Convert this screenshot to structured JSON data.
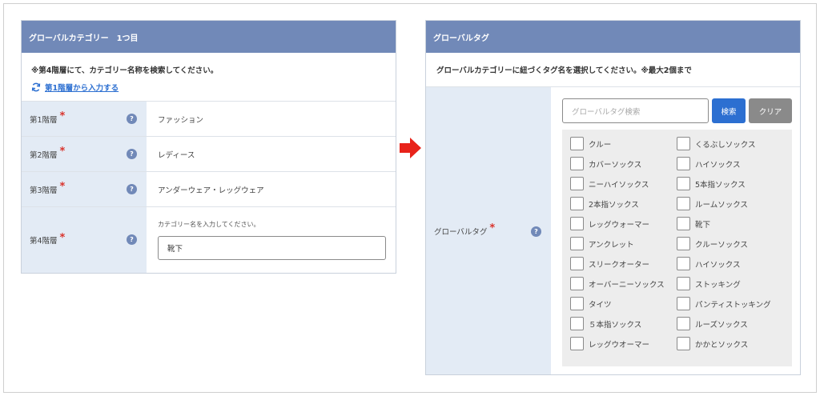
{
  "left_panel": {
    "title": "グローバルカテゴリー　1つ目",
    "notice": "※第4階層にて、カテゴリー名称を検索してください。",
    "link_text": "第1階層から入力する",
    "rows": [
      {
        "label": "第1階層",
        "value": "ファッション"
      },
      {
        "label": "第2階層",
        "value": "レディース"
      },
      {
        "label": "第3階層",
        "value": "アンダーウェア・レッグウェア"
      }
    ],
    "row4": {
      "label": "第4階層",
      "hint": "カテゴリー名を入力してください。",
      "input_value": "靴下"
    }
  },
  "right_panel": {
    "title": "グローバルタグ",
    "instruction": "グローバルカテゴリーに紐づくタグ名を選択してください。※最大2個まで",
    "label": "グローバルタグ",
    "search_placeholder": "グローバルタグ検索",
    "search_button": "検索",
    "clear_button": "クリア",
    "tags_col1": [
      "クルー",
      "カバーソックス",
      "ニーハイソックス",
      "2本指ソックス",
      "レッグウォーマー",
      "アンクレット",
      "スリークオーター",
      "オーバーニーソックス",
      "タイツ",
      "５本指ソックス",
      "レッグウオーマー"
    ],
    "tags_col2": [
      "くるぶしソックス",
      "ハイソックス",
      "5本指ソックス",
      "ルームソックス",
      "靴下",
      "クルーソックス",
      "ハイソックス",
      "ストッキング",
      "パンティストッキング",
      "ルーズソックス",
      "かかとソックス"
    ]
  },
  "colors": {
    "header": "#7189b8",
    "label_bg": "#e3ebf5",
    "link": "#2c6fd1",
    "required": "#d9322b",
    "arrow": "#e8231a"
  },
  "icons": {
    "help": "?",
    "refresh": "refresh-icon",
    "arrow": "arrow-right-icon"
  }
}
